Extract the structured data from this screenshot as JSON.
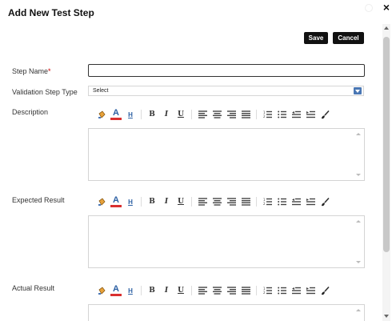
{
  "dialog": {
    "title": "Add New Test Step",
    "close_symbol": "×"
  },
  "actions": {
    "save_label": "Save",
    "cancel_label": "Cancel"
  },
  "form": {
    "step_name_label": "Step Name",
    "required_marker": "*",
    "step_name_value": "",
    "validation_type_label": "Validation Step Type",
    "validation_type_value": "Select",
    "description_label": "Description",
    "expected_result_label": "Expected Result",
    "actual_result_label": "Actual Result"
  },
  "toolbar_buttons": {
    "font_color": "A",
    "highlight": "H",
    "bold": "B",
    "italic": "I",
    "underline": "U"
  },
  "colors": {
    "button_bg": "#111111",
    "select_arrow": "#4a77b4",
    "required": "#cc0000",
    "font_color_underline": "#d93030",
    "icon_blue": "#2b5fa3"
  },
  "icons": [
    "paint-bucket-icon",
    "font-color-icon",
    "highlight-color-icon",
    "bold-icon",
    "italic-icon",
    "underline-icon",
    "align-left-icon",
    "align-center-icon",
    "align-right-icon",
    "justify-icon",
    "numbered-list-icon",
    "bulleted-list-icon",
    "outdent-icon",
    "indent-icon",
    "clear-format-brush-icon"
  ]
}
